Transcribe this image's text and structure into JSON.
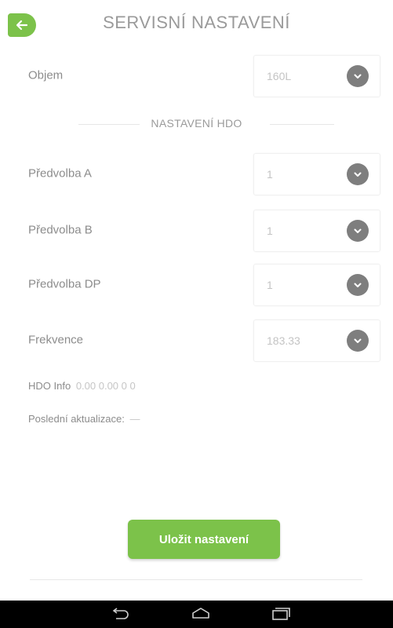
{
  "header": {
    "title": "SERVISNÍ NASTAVENÍ",
    "back_icon": "arrow-left-icon",
    "accent_color": "#7cc24a"
  },
  "volume": {
    "label": "Objem",
    "value": "160L"
  },
  "hdo_section": {
    "title": "NASTAVENÍ HDO",
    "fields": [
      {
        "label": "Předvolba A",
        "value": "1"
      },
      {
        "label": "Předvolba B",
        "value": "1"
      },
      {
        "label": "Předvolba DP",
        "value": "1"
      },
      {
        "label": "Frekvence",
        "value": "183.33"
      }
    ]
  },
  "info": {
    "hdo_label": "HDO Info",
    "hdo_value": "0.00 0.00 0 0",
    "update_label": "Poslední aktualizace:",
    "update_value": "—"
  },
  "actions": {
    "save_label": "Uložit nastavení"
  },
  "navbar": {
    "back_icon": "nav-back-icon",
    "home_icon": "nav-home-icon",
    "recents_icon": "nav-recents-icon"
  }
}
